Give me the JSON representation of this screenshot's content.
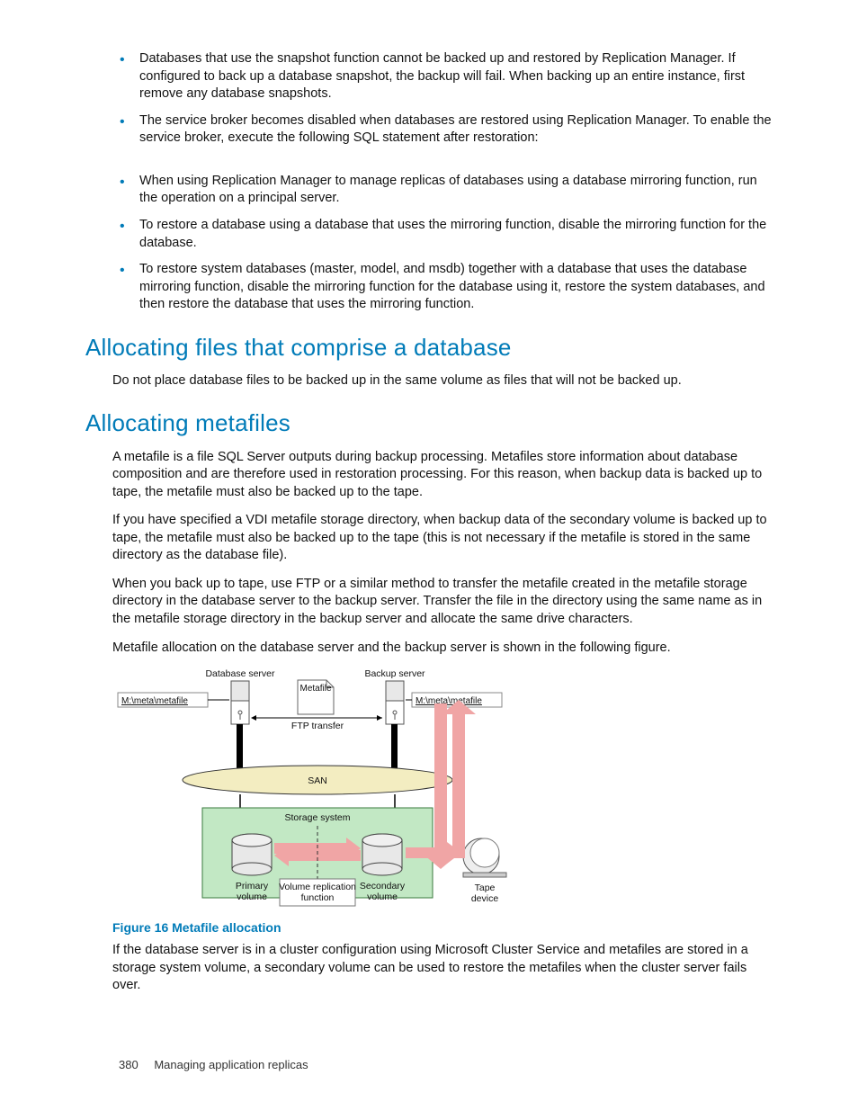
{
  "bullets_top": {
    "b1": "Databases that use the snapshot function cannot be backed up and restored by Replication Manager. If configured to back up a database snapshot, the backup will fail. When backing up an entire instance, first remove any database snapshots.",
    "b2": "The service broker becomes disabled when databases are restored using Replication Manager. To enable the service broker, execute the following SQL statement after restoration:"
  },
  "bullets_mid": {
    "b3": "When using Replication Manager to manage replicas of databases using a database mirroring function, run the operation on a principal server.",
    "b4": "To restore a database using a database that uses the mirroring function, disable the mirroring function for the database.",
    "b5": "To restore system databases (master, model, and msdb) together with a database that uses the database mirroring function, disable the mirroring function for the database using it, restore the system databases, and then restore the database that uses the mirroring function."
  },
  "h1": "Allocating files that comprise a database",
  "p1": "Do not place database files to be backed up in the same volume as files that will not be backed up.",
  "h2": "Allocating metafiles",
  "p2": "A metafile is a file SQL Server outputs during backup processing. Metafiles store information about database composition and are therefore used in restoration processing. For this reason, when backup data is backed up to tape, the metafile must also be backed up to the tape.",
  "p3": "If you have specified a VDI metafile storage directory, when backup data of the secondary volume is backed up to tape, the metafile must also be backed up to the tape (this is not necessary if the metafile is stored in the same directory as the database file).",
  "p4": "When you back up to tape, use FTP or a similar method to transfer the metafile created in the metafile storage directory in the database server to the backup server. Transfer the file in the directory using the same name as in the metafile storage directory in the backup server and allocate the same drive characters.",
  "p5": "Metafile allocation on the database server and the backup server is shown in the following figure.",
  "figcap": "Figure 16 Metafile allocation",
  "p6": "If the database server is in a cluster configuration using Microsoft Cluster Service and metafiles are stored in a storage system volume, a secondary volume can be used to restore the metafiles when the cluster server fails over.",
  "footer_page": "380",
  "footer_text": "Managing application replicas",
  "diagram": {
    "db_server": "Database server",
    "bk_server": "Backup server",
    "metafile_box": "Metafile",
    "path1": "M:\\meta\\metafile",
    "path2": "M:\\meta\\metafile",
    "ftp": "FTP transfer",
    "san": "SAN",
    "storage": "Storage system",
    "pvol1": "Primary",
    "pvol2": "volume",
    "repl1": "Volume replication",
    "repl2": "function",
    "svol1": "Secondary",
    "svol2": "volume",
    "tape1": "Tape",
    "tape2": "device"
  }
}
